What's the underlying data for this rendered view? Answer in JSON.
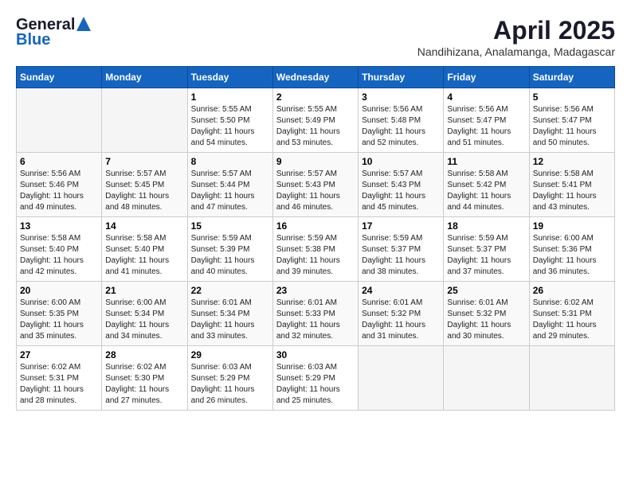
{
  "header": {
    "logo_general": "General",
    "logo_blue": "Blue",
    "month": "April 2025",
    "location": "Nandihizana, Analamanga, Madagascar"
  },
  "weekdays": [
    "Sunday",
    "Monday",
    "Tuesday",
    "Wednesday",
    "Thursday",
    "Friday",
    "Saturday"
  ],
  "weeks": [
    [
      {
        "day": "",
        "info": ""
      },
      {
        "day": "",
        "info": ""
      },
      {
        "day": "1",
        "info": "Sunrise: 5:55 AM\nSunset: 5:50 PM\nDaylight: 11 hours and 54 minutes."
      },
      {
        "day": "2",
        "info": "Sunrise: 5:55 AM\nSunset: 5:49 PM\nDaylight: 11 hours and 53 minutes."
      },
      {
        "day": "3",
        "info": "Sunrise: 5:56 AM\nSunset: 5:48 PM\nDaylight: 11 hours and 52 minutes."
      },
      {
        "day": "4",
        "info": "Sunrise: 5:56 AM\nSunset: 5:47 PM\nDaylight: 11 hours and 51 minutes."
      },
      {
        "day": "5",
        "info": "Sunrise: 5:56 AM\nSunset: 5:47 PM\nDaylight: 11 hours and 50 minutes."
      }
    ],
    [
      {
        "day": "6",
        "info": "Sunrise: 5:56 AM\nSunset: 5:46 PM\nDaylight: 11 hours and 49 minutes."
      },
      {
        "day": "7",
        "info": "Sunrise: 5:57 AM\nSunset: 5:45 PM\nDaylight: 11 hours and 48 minutes."
      },
      {
        "day": "8",
        "info": "Sunrise: 5:57 AM\nSunset: 5:44 PM\nDaylight: 11 hours and 47 minutes."
      },
      {
        "day": "9",
        "info": "Sunrise: 5:57 AM\nSunset: 5:43 PM\nDaylight: 11 hours and 46 minutes."
      },
      {
        "day": "10",
        "info": "Sunrise: 5:57 AM\nSunset: 5:43 PM\nDaylight: 11 hours and 45 minutes."
      },
      {
        "day": "11",
        "info": "Sunrise: 5:58 AM\nSunset: 5:42 PM\nDaylight: 11 hours and 44 minutes."
      },
      {
        "day": "12",
        "info": "Sunrise: 5:58 AM\nSunset: 5:41 PM\nDaylight: 11 hours and 43 minutes."
      }
    ],
    [
      {
        "day": "13",
        "info": "Sunrise: 5:58 AM\nSunset: 5:40 PM\nDaylight: 11 hours and 42 minutes."
      },
      {
        "day": "14",
        "info": "Sunrise: 5:58 AM\nSunset: 5:40 PM\nDaylight: 11 hours and 41 minutes."
      },
      {
        "day": "15",
        "info": "Sunrise: 5:59 AM\nSunset: 5:39 PM\nDaylight: 11 hours and 40 minutes."
      },
      {
        "day": "16",
        "info": "Sunrise: 5:59 AM\nSunset: 5:38 PM\nDaylight: 11 hours and 39 minutes."
      },
      {
        "day": "17",
        "info": "Sunrise: 5:59 AM\nSunset: 5:37 PM\nDaylight: 11 hours and 38 minutes."
      },
      {
        "day": "18",
        "info": "Sunrise: 5:59 AM\nSunset: 5:37 PM\nDaylight: 11 hours and 37 minutes."
      },
      {
        "day": "19",
        "info": "Sunrise: 6:00 AM\nSunset: 5:36 PM\nDaylight: 11 hours and 36 minutes."
      }
    ],
    [
      {
        "day": "20",
        "info": "Sunrise: 6:00 AM\nSunset: 5:35 PM\nDaylight: 11 hours and 35 minutes."
      },
      {
        "day": "21",
        "info": "Sunrise: 6:00 AM\nSunset: 5:34 PM\nDaylight: 11 hours and 34 minutes."
      },
      {
        "day": "22",
        "info": "Sunrise: 6:01 AM\nSunset: 5:34 PM\nDaylight: 11 hours and 33 minutes."
      },
      {
        "day": "23",
        "info": "Sunrise: 6:01 AM\nSunset: 5:33 PM\nDaylight: 11 hours and 32 minutes."
      },
      {
        "day": "24",
        "info": "Sunrise: 6:01 AM\nSunset: 5:32 PM\nDaylight: 11 hours and 31 minutes."
      },
      {
        "day": "25",
        "info": "Sunrise: 6:01 AM\nSunset: 5:32 PM\nDaylight: 11 hours and 30 minutes."
      },
      {
        "day": "26",
        "info": "Sunrise: 6:02 AM\nSunset: 5:31 PM\nDaylight: 11 hours and 29 minutes."
      }
    ],
    [
      {
        "day": "27",
        "info": "Sunrise: 6:02 AM\nSunset: 5:31 PM\nDaylight: 11 hours and 28 minutes."
      },
      {
        "day": "28",
        "info": "Sunrise: 6:02 AM\nSunset: 5:30 PM\nDaylight: 11 hours and 27 minutes."
      },
      {
        "day": "29",
        "info": "Sunrise: 6:03 AM\nSunset: 5:29 PM\nDaylight: 11 hours and 26 minutes."
      },
      {
        "day": "30",
        "info": "Sunrise: 6:03 AM\nSunset: 5:29 PM\nDaylight: 11 hours and 25 minutes."
      },
      {
        "day": "",
        "info": ""
      },
      {
        "day": "",
        "info": ""
      },
      {
        "day": "",
        "info": ""
      }
    ]
  ]
}
